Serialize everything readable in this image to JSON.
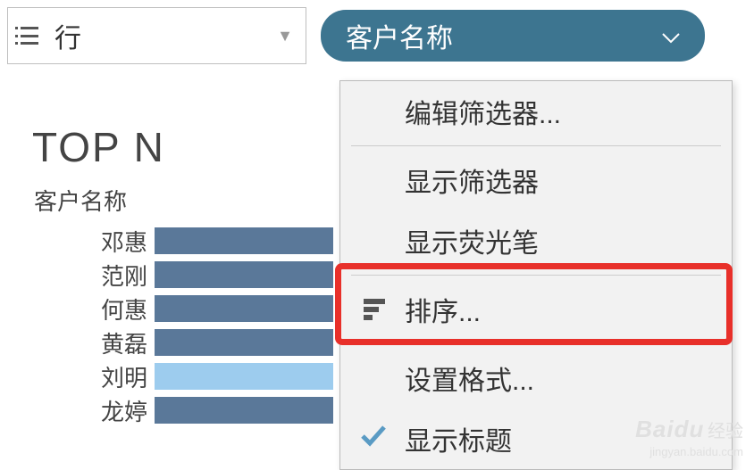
{
  "toolbar": {
    "row_label": "行",
    "pill_label": "客户名称"
  },
  "menu": {
    "edit_filter": "编辑筛选器...",
    "show_filter": "显示筛选器",
    "show_highlighter": "显示荧光笔",
    "sort": "排序...",
    "format": "设置格式...",
    "show_title": "显示标题"
  },
  "chart_data": {
    "type": "bar",
    "title": "TOP N",
    "ylabel": "客户名称",
    "xlabel": "",
    "categories": [
      "邓惠",
      "范刚",
      "何惠",
      "黄磊",
      "刘明",
      "龙婷"
    ],
    "values": [
      210,
      210,
      210,
      210,
      210,
      210
    ],
    "xlim": [
      0,
      220
    ],
    "selected_index": 4
  },
  "watermark": {
    "brand": "Baidu",
    "brand_cn": "经验",
    "url": "jingyan.baidu.com"
  }
}
